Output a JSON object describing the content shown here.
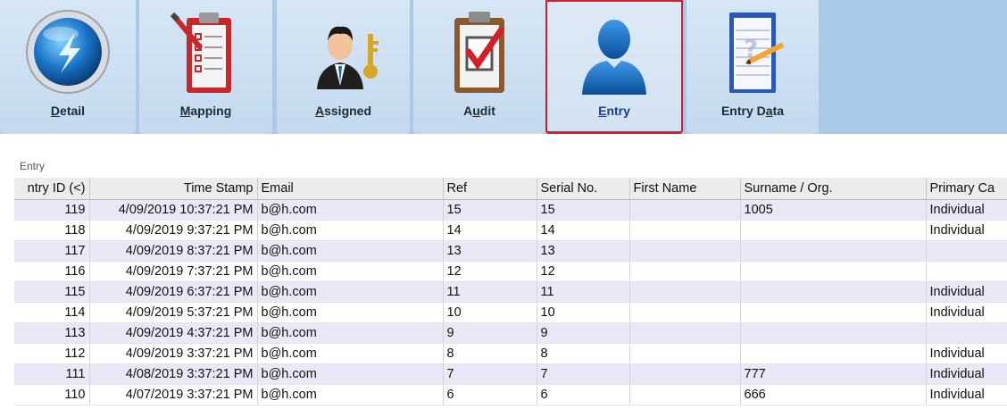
{
  "tabs": [
    {
      "label": "Detail",
      "icon": "lightning-orb-icon",
      "active": false
    },
    {
      "label": "Mapping",
      "icon": "clipboard-checklist-icon",
      "active": false
    },
    {
      "label": "Assigned",
      "icon": "person-key-icon",
      "active": false
    },
    {
      "label": "Audit",
      "icon": "clipboard-check-icon",
      "active": false
    },
    {
      "label": "Entry",
      "icon": "person-silhouette-icon",
      "active": true
    },
    {
      "label": "Entry Data",
      "icon": "clipboard-pencil-icon",
      "active": false
    }
  ],
  "section_title": "Entry",
  "table": {
    "columns": [
      "ntry ID (<)",
      "Time Stamp",
      "Email",
      "Ref",
      "Serial No.",
      "First Name",
      "Surname / Org.",
      "Primary Ca"
    ],
    "rows": [
      [
        "119",
        "4/09/2019 10:37:21 PM",
        "b@h.com",
        "15",
        "15",
        "",
        "1005",
        "Individual"
      ],
      [
        "118",
        "4/09/2019 9:37:21 PM",
        "b@h.com",
        "14",
        "14",
        "",
        "",
        "Individual"
      ],
      [
        "117",
        "4/09/2019 8:37:21 PM",
        "b@h.com",
        "13",
        "13",
        "",
        "",
        ""
      ],
      [
        "116",
        "4/09/2019 7:37:21 PM",
        "b@h.com",
        "12",
        "12",
        "",
        "",
        ""
      ],
      [
        "115",
        "4/09/2019 6:37:21 PM",
        "b@h.com",
        "11",
        "11",
        "",
        "",
        "Individual"
      ],
      [
        "114",
        "4/09/2019 5:37:21 PM",
        "b@h.com",
        "10",
        "10",
        "",
        "",
        "Individual"
      ],
      [
        "113",
        "4/09/2019 4:37:21 PM",
        "b@h.com",
        "9",
        "9",
        "",
        "",
        ""
      ],
      [
        "112",
        "4/09/2019 3:37:21 PM",
        "b@h.com",
        "8",
        "8",
        "",
        "",
        "Individual"
      ],
      [
        "111",
        "4/08/2019 3:37:21 PM",
        "b@h.com",
        "7",
        "7",
        "",
        "777",
        "Individual"
      ],
      [
        "110",
        "4/07/2019 3:37:21 PM",
        "b@h.com",
        "6",
        "6",
        "",
        "666",
        "Individual"
      ]
    ]
  },
  "colors": {
    "active_tab_border": "#d11f2b",
    "alt_row": "#e9e8f6",
    "ribbon": "#a9c9e8"
  }
}
